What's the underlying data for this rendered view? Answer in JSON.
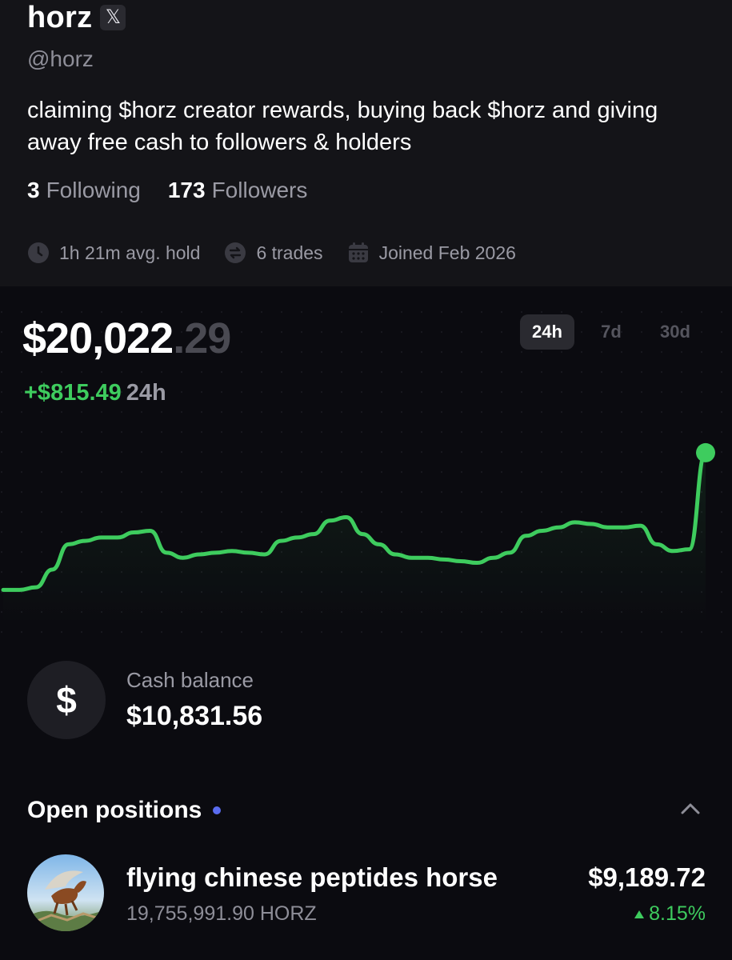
{
  "profile": {
    "name": "horz",
    "x_icon": "x-logo-icon",
    "handle": "@horz",
    "bio": "claiming $horz creator rewards, buying back $horz and giving away free cash to followers & holders",
    "following_count": "3",
    "following_label": "Following",
    "followers_count": "173",
    "followers_label": "Followers",
    "meta": {
      "avg_hold": "1h 21m avg. hold",
      "trades": "6 trades",
      "joined": "Joined Feb 2026"
    }
  },
  "portfolio": {
    "balance_whole": "$20,022",
    "balance_cents": ".29",
    "change_value": "+$815.49",
    "change_period": "24h",
    "periods": [
      "24h",
      "7d",
      "30d"
    ],
    "active_period": "24h",
    "line_color": "#3ecc5e"
  },
  "chart_data": {
    "type": "line",
    "title": "",
    "xlabel": "",
    "ylabel": "",
    "grid": true,
    "series": [
      {
        "values": [
          19210,
          19210,
          19225,
          19330,
          19480,
          19500,
          19520,
          19520,
          19550,
          19560,
          19430,
          19400,
          19420,
          19430,
          19440,
          19430,
          19420,
          19500,
          19520,
          19540,
          19620,
          19640,
          19540,
          19480,
          19420,
          19400,
          19400,
          19390,
          19380,
          19370,
          19400,
          19430,
          19530,
          19560,
          19580,
          19610,
          19600,
          19580,
          19580,
          19590,
          19480,
          19440,
          19450,
          20022
        ]
      }
    ]
  },
  "cash": {
    "icon": "dollar-icon",
    "label": "Cash balance",
    "value": "$10,831.56"
  },
  "positions": {
    "title": "Open positions",
    "items": [
      {
        "name": "flying chinese peptides horse",
        "amount": "19,755,991.90 HORZ",
        "value": "$9,189.72",
        "change": "8.15%"
      }
    ]
  }
}
